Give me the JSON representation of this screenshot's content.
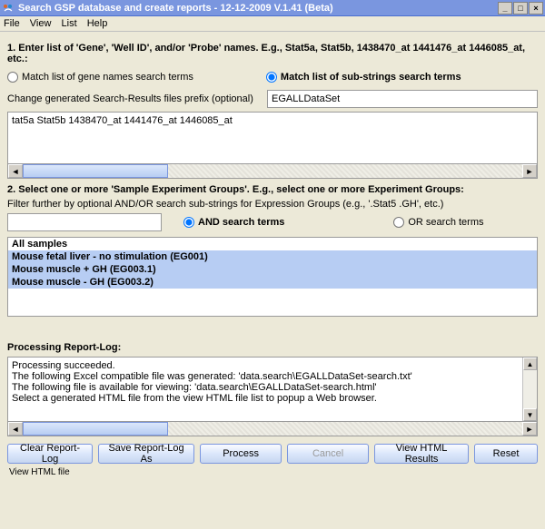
{
  "window": {
    "title": "Search GSP database and create reports - 12-12-2009 V.1.41 (Beta)"
  },
  "menubar": [
    "File",
    "View",
    "List",
    "Help"
  ],
  "step1": {
    "heading": "1. Enter list of 'Gene', 'Well ID', and/or 'Probe' names. E.g., Stat5a, Stat5b, 1438470_at 1441476_at 1446085_at, etc.:",
    "radio_gene": "Match list of gene names search terms",
    "radio_sub": "Match list of sub-strings search terms",
    "prefix_label": "Change generated Search-Results files prefix (optional)",
    "prefix_value": "EGALLDataSet",
    "textarea_value": "tat5a Stat5b 1438470_at 1441476_at 1446085_at"
  },
  "step2": {
    "heading": "2. Select one or more 'Sample Experiment Groups'. E.g., select one or more Experiment Groups:",
    "filter_label": "Filter further by optional AND/OR search sub-strings for Expression Groups (e.g., '.Stat5 .GH', etc.)",
    "filter_value": "",
    "radio_and": "AND search terms",
    "radio_or": "OR search terms",
    "list": [
      "All samples",
      "Mouse fetal liver - no stimulation (EG001)",
      "Mouse muscle + GH (EG003.1)",
      "Mouse muscle - GH (EG003.2)"
    ]
  },
  "report": {
    "heading": "Processing Report-Log:",
    "lines": [
      "Processing succeeded.",
      "The following Excel compatible file was generated: 'data.search\\EGALLDataSet-search.txt'",
      "The following file is available for viewing: 'data.search\\EGALLDataSet-search.html'",
      "Select a generated HTML file from the view HTML file list to popup a Web browser."
    ]
  },
  "buttons": {
    "clear": "Clear Report-Log",
    "save": "Save Report-Log As",
    "process": "Process",
    "cancel": "Cancel",
    "view": "View HTML Results",
    "reset": "Reset"
  },
  "status": "View HTML file"
}
